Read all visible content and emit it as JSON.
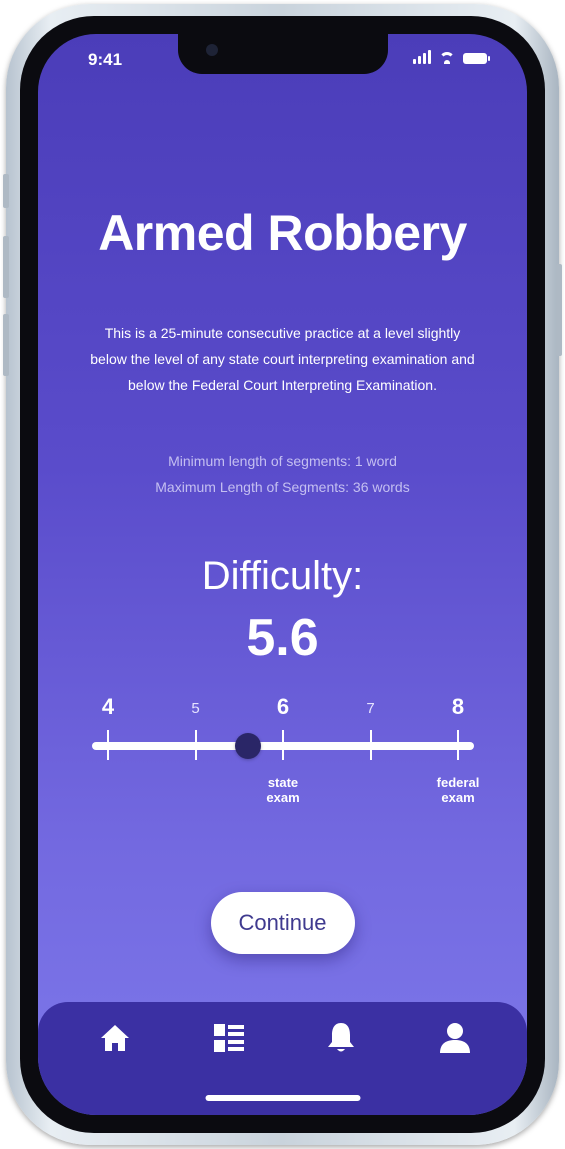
{
  "status_bar": {
    "time": "9:41"
  },
  "practice": {
    "title": "Armed Robbery",
    "description": "This is a 25-minute consecutive practice at a level slightly below the level of any state court interpreting examination and below the Federal Court Interpreting Examination.",
    "segments_min": "Minimum length of segments: 1 word",
    "segments_max": "Maximum Length of Segments: 36 words"
  },
  "difficulty": {
    "label": "Difficulty:",
    "value_text": "5.6",
    "value": 5.6,
    "scale_min": 4,
    "scale_max": 8,
    "ticks": [
      {
        "value": 4,
        "label": "4",
        "major": true
      },
      {
        "value": 5,
        "label": "5",
        "major": false
      },
      {
        "value": 6,
        "label": "6",
        "major": true
      },
      {
        "value": 7,
        "label": "7",
        "major": false
      },
      {
        "value": 8,
        "label": "8",
        "major": true
      }
    ],
    "markers": [
      {
        "value": 6,
        "line1": "state",
        "line2": "exam"
      },
      {
        "value": 8,
        "line1": "federal",
        "line2": "exam"
      }
    ]
  },
  "continue_button": {
    "label": "Continue"
  },
  "tab_bar": {
    "items": [
      {
        "icon": "home-icon"
      },
      {
        "icon": "list-icon"
      },
      {
        "icon": "bell-icon"
      },
      {
        "icon": "profile-icon"
      }
    ]
  },
  "colors": {
    "gradient_top": "#4b3db9",
    "gradient_bottom": "#7d78ea",
    "tab_bar": "#3b30a3",
    "slider_thumb": "#2a2667",
    "button_text": "#3f3a8f"
  }
}
